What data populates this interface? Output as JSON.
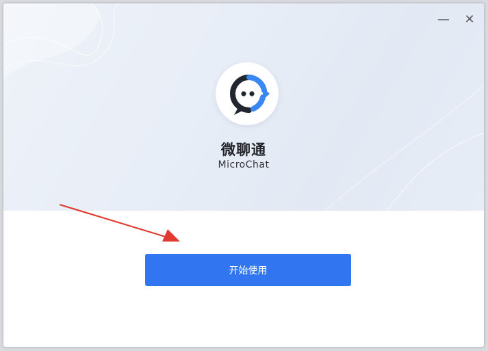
{
  "window": {
    "minimize_glyph": "—",
    "close_glyph": "✕"
  },
  "app": {
    "name_zh": "微聊通",
    "name_en": "MicroChat",
    "logo_icon": "chat-bubble-logo-icon"
  },
  "actions": {
    "start_label": "开始使用"
  },
  "colors": {
    "accent": "#3176f0",
    "logo_dark": "#22262e",
    "logo_blue": "#3a86f2",
    "annotation_arrow": "#e23a30"
  }
}
